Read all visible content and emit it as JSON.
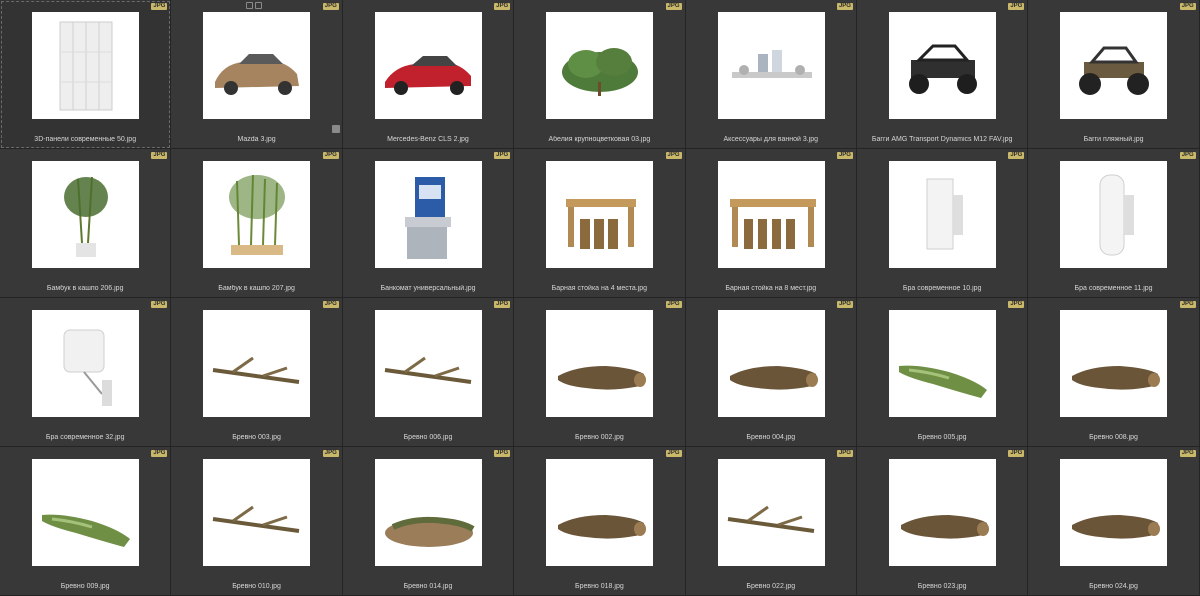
{
  "badge_label": "JPG",
  "items": [
    {
      "caption": "3D-панели современные 50.jpg",
      "icon": "wall-panel"
    },
    {
      "caption": "Mazda 3.jpg",
      "icon": "car-beige"
    },
    {
      "caption": "Mercedes-Benz CLS 2.jpg",
      "icon": "car-red"
    },
    {
      "caption": "Абелия крупноцветковая 03.jpg",
      "icon": "shrub"
    },
    {
      "caption": "Аксессуары для ванной 3.jpg",
      "icon": "bath-accessories"
    },
    {
      "caption": "Багги AMG Transport Dynamics M12 FAV.jpg",
      "icon": "buggy-military"
    },
    {
      "caption": "Багги пляжный.jpg",
      "icon": "buggy-beach"
    },
    {
      "caption": "Бамбук в кашпо 206.jpg",
      "icon": "bamboo-pot"
    },
    {
      "caption": "Бамбук в кашпо 207.jpg",
      "icon": "bamboo-planter"
    },
    {
      "caption": "Банкомат универсальный.jpg",
      "icon": "atm"
    },
    {
      "caption": "Барная стойка на 4 места.jpg",
      "icon": "bar-counter-4"
    },
    {
      "caption": "Барная стойка на 8 мест.jpg",
      "icon": "bar-counter-8"
    },
    {
      "caption": "Бра современное 10.jpg",
      "icon": "sconce"
    },
    {
      "caption": "Бра современное 11.jpg",
      "icon": "sconce-cylinder"
    },
    {
      "caption": "Бра современное 32.jpg",
      "icon": "sconce-lamp"
    },
    {
      "caption": "Бревно 003.jpg",
      "icon": "branch"
    },
    {
      "caption": "Бревно 006.jpg",
      "icon": "branch"
    },
    {
      "caption": "Бревно 002.jpg",
      "icon": "log"
    },
    {
      "caption": "Бревно 004.jpg",
      "icon": "log"
    },
    {
      "caption": "Бревно 005.jpg",
      "icon": "mossy-log"
    },
    {
      "caption": "Бревно 008.jpg",
      "icon": "log"
    },
    {
      "caption": "Бревно 009.jpg",
      "icon": "mossy-log"
    },
    {
      "caption": "Бревно 010.jpg",
      "icon": "branch"
    },
    {
      "caption": "Бревно 014.jpg",
      "icon": "log-ground"
    },
    {
      "caption": "Бревно 018.jpg",
      "icon": "log"
    },
    {
      "caption": "Бревно 022.jpg",
      "icon": "branch"
    },
    {
      "caption": "Бревно 023.jpg",
      "icon": "log"
    },
    {
      "caption": "Бревно 024.jpg",
      "icon": "log"
    }
  ]
}
